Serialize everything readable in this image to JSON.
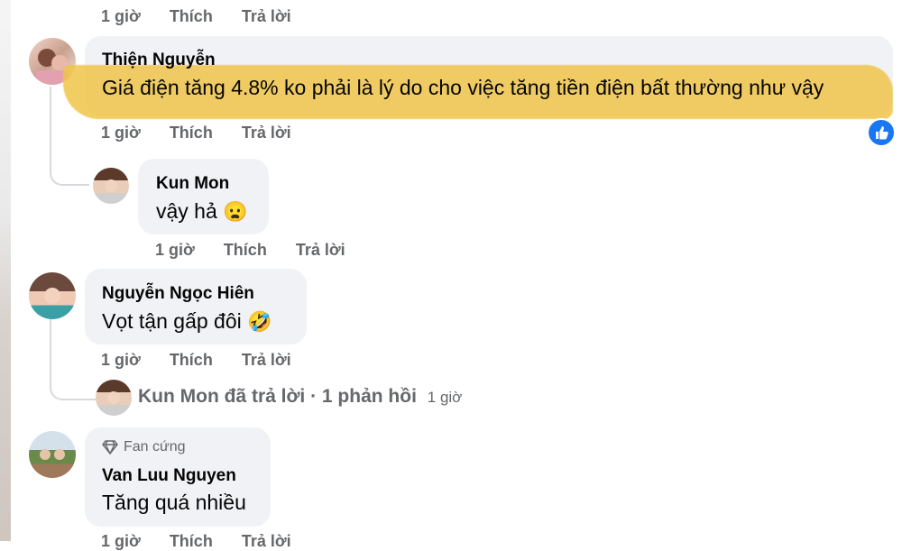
{
  "comments": [
    {
      "id": "top-partial",
      "meta": {
        "time": "1 giờ",
        "like": "Thích",
        "reply": "Trả lời"
      }
    },
    {
      "id": "thien",
      "author": "Thiện Nguyễn",
      "text": "Giá điện tăng 4.8% ko phải là lý do cho việc tăng tiền điện bất thường như vậy",
      "meta": {
        "time": "1 giờ",
        "like": "Thích",
        "reply": "Trả lời"
      },
      "reaction": "like-icon"
    },
    {
      "id": "kun-reply",
      "author": "Kun Mon",
      "text": "vậy hả",
      "emoji": "😦",
      "meta": {
        "time": "1 giờ",
        "like": "Thích",
        "reply": "Trả lời"
      }
    },
    {
      "id": "hien",
      "author": "Nguyễn Ngọc Hiên",
      "text": "Vọt tận gấp đôi",
      "emoji": "🤣",
      "meta": {
        "time": "1 giờ",
        "like": "Thích",
        "reply": "Trả lời"
      },
      "replies_summary": {
        "text": "Kun Mon đã trả lời · 1 phản hồi",
        "time": "1 giờ"
      }
    },
    {
      "id": "van",
      "badge": "Fan cứng",
      "author": "Van Luu Nguyen",
      "text": "Tăng quá nhiều",
      "meta": {
        "time": "1 giờ",
        "like": "Thích",
        "reply": "Trả lời"
      }
    }
  ],
  "colors": {
    "bubble": "#f0f2f5",
    "meta": "#65676b",
    "highlight": "#f0c54a",
    "like_blue": "#1877f2"
  }
}
